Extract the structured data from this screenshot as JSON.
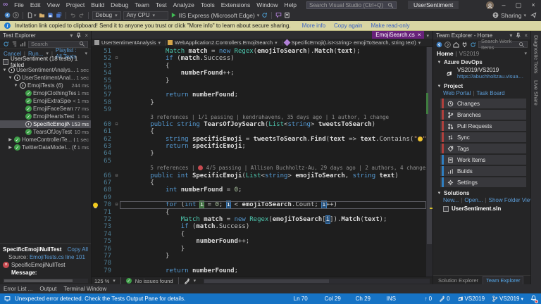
{
  "titlebar": {
    "logo": "∞",
    "menus": [
      "File",
      "Edit",
      "View",
      "Project",
      "Build",
      "Debug",
      "Team",
      "Test",
      "Analyze",
      "Tools",
      "Extensions",
      "Window",
      "Help"
    ],
    "search_placeholder": "Search Visual Studio (Ctrl+Q)",
    "solution": "UserSentiment"
  },
  "toolbar": {
    "config": "Debug",
    "platform": "Any CPU",
    "run_label": "IIS Express (Microsoft Edge)",
    "sharing_label": "Sharing"
  },
  "notification": {
    "text": "Invitation link copied to clipboard! Send it to anyone you trust or click \"More info\" to learn about secure sharing.",
    "links": [
      "More info",
      "Copy again",
      "Make read-only"
    ]
  },
  "test_explorer": {
    "title": "Test Explorer",
    "search_placeholder": "Search",
    "actions": {
      "cancel": "Cancel",
      "run": "Run...",
      "playlist": "Playlist : All Tests"
    },
    "summary": "UserSentiment (18 tests) 1 failed",
    "tree": [
      {
        "i": 0,
        "caret": "▼",
        "icon": "clock",
        "label": "UserSentimentAnalys... (18)",
        "dur": "1 sec"
      },
      {
        "i": 1,
        "caret": "▼",
        "icon": "clock",
        "label": "UserSentimentAnal... (18)",
        "dur": "1 sec"
      },
      {
        "i": 2,
        "caret": "▼",
        "icon": "clock",
        "label": "EmojiTests (6)",
        "dur": "244 ms"
      },
      {
        "i": 3,
        "icon": "pass",
        "label": "EmojiClothingTest",
        "dur": "1 ms"
      },
      {
        "i": 3,
        "icon": "pass",
        "label": "EmojiExtraSpecial...",
        "dur": "< 1 ms"
      },
      {
        "i": 3,
        "icon": "pass",
        "label": "EmojiFaceSearchTest",
        "dur": "77 ms"
      },
      {
        "i": 3,
        "icon": "pass",
        "label": "EmojiHeartsTest",
        "dur": "1 ms"
      },
      {
        "i": 3,
        "icon": "clock",
        "label": "SpecificEmojiNull...",
        "dur": "153 ms",
        "selected": true
      },
      {
        "i": 3,
        "icon": "pass",
        "label": "TearsOfJoyTest",
        "dur": "10 ms"
      },
      {
        "i": 1,
        "caret": "▶",
        "icon": "pass",
        "label": "HomeControllerTe... (6)",
        "dur": "1 sec"
      },
      {
        "i": 1,
        "caret": "▶",
        "icon": "pass",
        "label": "TwitterDataModel... (6)",
        "dur": "1 ms"
      }
    ],
    "details": {
      "title": "SpecificEmojiNullTest",
      "copy_all": "Copy All",
      "source_label": "Source:",
      "source_link": "EmojiTests.cs line 101",
      "result_name": "SpecificEmojiNullTest",
      "message_label": "Message:"
    }
  },
  "editor": {
    "tab": "EmojiSearch.cs",
    "breadcrumbs": [
      "UserSentimentAnalysis",
      "WebApplication2.Controllers.EmojiSearch",
      "SpecificEmoji(List<string> emojiToSearch, string text)"
    ],
    "zoom": "125 %",
    "status": "No issues found",
    "lines": [
      {
        "n": 51,
        "ind": 12,
        "s": [
          [
            "t",
            "Match"
          ],
          [
            "p",
            " "
          ],
          [
            "v",
            "match"
          ],
          [
            "p",
            " = "
          ],
          [
            "k",
            "new"
          ],
          [
            "p",
            " "
          ],
          [
            "t",
            "Regex"
          ],
          [
            "p",
            "("
          ],
          [
            "v",
            "emojiToSearch"
          ],
          [
            "p",
            ")."
          ],
          [
            "v",
            "Match"
          ],
          [
            "p",
            "("
          ],
          [
            "v",
            "text"
          ],
          [
            "p",
            ");"
          ]
        ]
      },
      {
        "n": 52,
        "ind": 12,
        "fold": true,
        "s": [
          [
            "k",
            "if"
          ],
          [
            "p",
            " ("
          ],
          [
            "v",
            "match"
          ],
          [
            "p",
            ".Success)"
          ]
        ]
      },
      {
        "n": 53,
        "ind": 12,
        "s": [
          [
            "p",
            "{"
          ]
        ]
      },
      {
        "n": 54,
        "ind": 16,
        "s": [
          [
            "v",
            "numberFound"
          ],
          [
            "p",
            "++;"
          ]
        ]
      },
      {
        "n": 55,
        "ind": 12,
        "s": [
          [
            "p",
            "}"
          ]
        ]
      },
      {
        "n": 56,
        "ind": 0,
        "s": []
      },
      {
        "n": 57,
        "ind": 12,
        "s": [
          [
            "k",
            "return"
          ],
          [
            "p",
            " "
          ],
          [
            "v",
            "numberFound"
          ],
          [
            "p",
            ";"
          ]
        ]
      },
      {
        "n": 58,
        "ind": 8,
        "s": [
          [
            "p",
            "}"
          ]
        ]
      },
      {
        "n": 59,
        "ind": 0,
        "s": []
      },
      {
        "lens": true,
        "ind": 8,
        "s": [
          [
            "c",
            "3 references | 1/1 passing | kendrahavens, 35 days ago | 1 author, 1 change"
          ]
        ]
      },
      {
        "n": 60,
        "ind": 8,
        "fold": true,
        "s": [
          [
            "k",
            "public"
          ],
          [
            "p",
            " "
          ],
          [
            "k",
            "string"
          ],
          [
            "p",
            " "
          ],
          [
            "v",
            "TearsOfJoySearch"
          ],
          [
            "p",
            "("
          ],
          [
            "t",
            "List"
          ],
          [
            "p",
            "<"
          ],
          [
            "k",
            "string"
          ],
          [
            "p",
            "> "
          ],
          [
            "v",
            "tweetsToSearch"
          ],
          [
            "p",
            ")"
          ]
        ]
      },
      {
        "n": 61,
        "ind": 8,
        "s": [
          [
            "p",
            "{"
          ]
        ]
      },
      {
        "n": 62,
        "ind": 12,
        "s": [
          [
            "k",
            "string"
          ],
          [
            "p",
            " "
          ],
          [
            "v",
            "specificEmoji"
          ],
          [
            "p",
            " = "
          ],
          [
            "v",
            "tweetsToSearch"
          ],
          [
            "p",
            "."
          ],
          [
            "v",
            "Find"
          ],
          [
            "p",
            "("
          ],
          [
            "v",
            "text"
          ],
          [
            "p",
            " => "
          ],
          [
            "v",
            "text"
          ],
          [
            "p",
            ".Contains("
          ],
          [
            "s",
            "\""
          ],
          [
            "e",
            "😂"
          ],
          [
            "s",
            "\""
          ],
          [
            "p",
            "));"
          ]
        ]
      },
      {
        "n": 63,
        "ind": 12,
        "s": [
          [
            "k",
            "return"
          ],
          [
            "p",
            " "
          ],
          [
            "v",
            "specificEmoji"
          ],
          [
            "p",
            ";"
          ]
        ]
      },
      {
        "n": 64,
        "ind": 8,
        "s": [
          [
            "p",
            "}"
          ]
        ]
      },
      {
        "n": 65,
        "ind": 0,
        "s": []
      },
      {
        "lens": true,
        "ind": 8,
        "s": [
          [
            "c",
            "5 references | "
          ],
          [
            "err",
            ""
          ],
          [
            "c",
            " 4/5 passing | Allison Buchholtz-Au, 29 days ago | 2 authors, 4 changes"
          ]
        ]
      },
      {
        "n": 66,
        "ind": 8,
        "fold": true,
        "s": [
          [
            "k",
            "public"
          ],
          [
            "p",
            " "
          ],
          [
            "k",
            "int"
          ],
          [
            "p",
            " "
          ],
          [
            "v",
            "SpecificEmoji"
          ],
          [
            "p",
            "("
          ],
          [
            "t",
            "List"
          ],
          [
            "p",
            "<"
          ],
          [
            "k",
            "string"
          ],
          [
            "p",
            "> "
          ],
          [
            "v",
            "emojiToSearch"
          ],
          [
            "p",
            ", "
          ],
          [
            "k",
            "string"
          ],
          [
            "p",
            " "
          ],
          [
            "v",
            "text"
          ],
          [
            "p",
            ")"
          ]
        ]
      },
      {
        "n": 67,
        "ind": 8,
        "s": [
          [
            "p",
            "{"
          ]
        ]
      },
      {
        "n": 68,
        "ind": 12,
        "s": [
          [
            "k",
            "int"
          ],
          [
            "p",
            " "
          ],
          [
            "v",
            "numberFound"
          ],
          [
            "p",
            " = "
          ],
          [
            "n2",
            "0"
          ],
          [
            "p",
            ";"
          ]
        ]
      },
      {
        "n": 69,
        "ind": 0,
        "s": []
      },
      {
        "n": 70,
        "ind": 12,
        "fold": true,
        "bulb": true,
        "box": true,
        "s": [
          [
            "k",
            "for"
          ],
          [
            "p",
            " ("
          ],
          [
            "k",
            "int"
          ],
          [
            "p",
            " "
          ],
          [
            "hg",
            "i"
          ],
          [
            "p",
            " = "
          ],
          [
            "n2",
            "0"
          ],
          [
            "p",
            "; "
          ],
          [
            "hb",
            "i"
          ],
          [
            "p",
            " < "
          ],
          [
            "v",
            "emojiToSearch"
          ],
          [
            "p",
            ".Count; "
          ],
          [
            "hb",
            "i"
          ],
          [
            "p",
            "++)"
          ]
        ]
      },
      {
        "n": 71,
        "ind": 12,
        "s": [
          [
            "p",
            "{"
          ]
        ]
      },
      {
        "n": 72,
        "ind": 16,
        "s": [
          [
            "t",
            "Match"
          ],
          [
            "p",
            " "
          ],
          [
            "v",
            "match"
          ],
          [
            "p",
            " = "
          ],
          [
            "k",
            "new"
          ],
          [
            "p",
            " "
          ],
          [
            "t",
            "Regex"
          ],
          [
            "p",
            "("
          ],
          [
            "v",
            "emojiToSearch"
          ],
          [
            "p",
            "["
          ],
          [
            "hb",
            "i"
          ],
          [
            "p",
            "])."
          ],
          [
            "v",
            "Match"
          ],
          [
            "p",
            "("
          ],
          [
            "v",
            "text"
          ],
          [
            "p",
            ");"
          ]
        ]
      },
      {
        "n": 73,
        "ind": 16,
        "s": [
          [
            "k",
            "if"
          ],
          [
            "p",
            " ("
          ],
          [
            "v",
            "match"
          ],
          [
            "p",
            ".Success)"
          ]
        ]
      },
      {
        "n": 74,
        "ind": 16,
        "s": [
          [
            "p",
            "{"
          ]
        ]
      },
      {
        "n": 75,
        "ind": 20,
        "s": [
          [
            "v",
            "numberFound"
          ],
          [
            "p",
            "++;"
          ]
        ]
      },
      {
        "n": 76,
        "ind": 16,
        "s": [
          [
            "p",
            "}"
          ]
        ]
      },
      {
        "n": 77,
        "ind": 12,
        "s": [
          [
            "p",
            "}"
          ]
        ]
      },
      {
        "n": 78,
        "ind": 0,
        "s": []
      },
      {
        "n": 79,
        "ind": 12,
        "s": [
          [
            "k",
            "return"
          ],
          [
            "p",
            " "
          ],
          [
            "v",
            "numberFound"
          ],
          [
            "p",
            ";"
          ]
        ]
      }
    ]
  },
  "team_explorer": {
    "title": "Team Explorer - Home",
    "search_placeholder": "Search Work Items",
    "home_label": "Home",
    "context": "VS2019",
    "azure": {
      "title": "Azure DevOps",
      "account": "VS2019/VS2019",
      "url": "https://abuchholtzau.visualstudio..."
    },
    "project": {
      "title": "Project",
      "links": [
        "Web Portal",
        "Task Board"
      ],
      "items": [
        {
          "label": "Changes",
          "icon": "changes",
          "accent": "#b0403c"
        },
        {
          "label": "Branches",
          "icon": "branches",
          "accent": "#b0403c"
        },
        {
          "label": "Pull Requests",
          "icon": "pr",
          "accent": "#b0403c"
        },
        {
          "label": "Sync",
          "icon": "sync",
          "accent": "#b0403c"
        },
        {
          "label": "Tags",
          "icon": "tag",
          "accent": "#b0403c"
        },
        {
          "label": "Work Items",
          "icon": "workitems",
          "accent": "#2f7fc1"
        },
        {
          "label": "Builds",
          "icon": "builds",
          "accent": "#2f7fc1"
        },
        {
          "label": "Settings",
          "icon": "gear",
          "accent": "#2f7fc1"
        }
      ]
    },
    "solutions": {
      "title": "Solutions",
      "links": [
        "New...",
        "Open...",
        "Show Folder View"
      ],
      "solution": "UserSentiment.sln"
    },
    "tabs": [
      "Solution Explorer",
      "Team Explorer"
    ]
  },
  "side_strip": {
    "tabs": [
      "Diagnostic Tools",
      "Live Share"
    ]
  },
  "bottom_tabs": [
    "Error List ...",
    "Output",
    "Terminal Window"
  ],
  "statusbar": {
    "message": "Unexpected error detected. Check the Tests Output Pane for details.",
    "ln": "Ln 70",
    "col": "Col 29",
    "ch": "Ch 29",
    "mode": "INS",
    "pushes": "0",
    "edits": "0",
    "account": "VS2019",
    "branch": "VS2019"
  },
  "colors": {
    "accent_purple": "#68217a",
    "status_blue": "#1673c5",
    "notification_bg": "#d9d6a3",
    "pass_green": "#3f9e49",
    "fail_red": "#c74a50"
  }
}
